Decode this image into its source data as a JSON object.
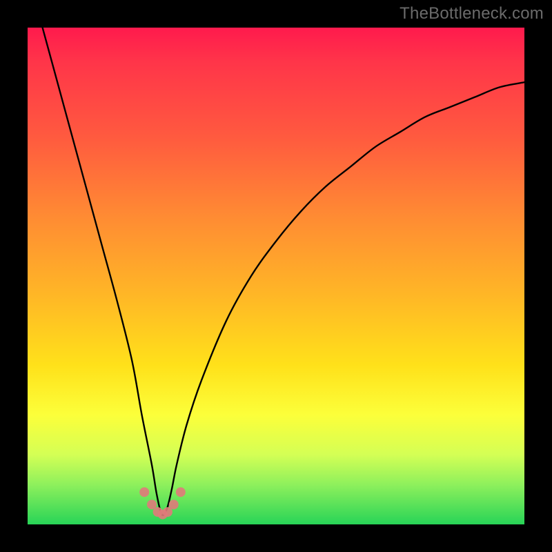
{
  "watermark": "TheBottleneck.com",
  "colors": {
    "frame": "#000000",
    "gradient_top": "#ff1a4d",
    "gradient_mid": "#ffe11a",
    "gradient_bottom": "#28d457",
    "curve_stroke": "#000000",
    "dot_fill": "#e07a7a"
  },
  "chart_data": {
    "type": "line",
    "title": "",
    "xlabel": "",
    "ylabel": "",
    "xlim": [
      0,
      100
    ],
    "ylim": [
      0,
      100
    ],
    "notes": "V-shaped bottleneck curve. x/y values are approximate, read off the plot area proportions (no axis ticks shown). Minimum (bottleneck optimum) near x≈27.",
    "series": [
      {
        "name": "bottleneck-curve",
        "x": [
          3,
          6,
          9,
          12,
          15,
          18,
          21,
          23,
          25,
          26,
          27,
          28,
          29,
          30,
          32,
          35,
          40,
          45,
          50,
          55,
          60,
          65,
          70,
          75,
          80,
          85,
          90,
          95,
          100
        ],
        "values": [
          100,
          89,
          78,
          67,
          56,
          45,
          33,
          22,
          12,
          6,
          2,
          3,
          7,
          12,
          20,
          29,
          41,
          50,
          57,
          63,
          68,
          72,
          76,
          79,
          82,
          84,
          86,
          88,
          89
        ]
      }
    ],
    "markers": [
      {
        "x": 23.5,
        "y": 6.5
      },
      {
        "x": 25.0,
        "y": 4.0
      },
      {
        "x": 26.2,
        "y": 2.5
      },
      {
        "x": 27.2,
        "y": 2.0
      },
      {
        "x": 28.2,
        "y": 2.5
      },
      {
        "x": 29.4,
        "y": 4.0
      },
      {
        "x": 30.8,
        "y": 6.5
      }
    ],
    "background_gradient": {
      "direction": "vertical",
      "stops": [
        {
          "pos": 0.0,
          "color": "#ff1a4d"
        },
        {
          "pos": 0.3,
          "color": "#ff7a36"
        },
        {
          "pos": 0.6,
          "color": "#ffd41f"
        },
        {
          "pos": 0.8,
          "color": "#f9ff3a"
        },
        {
          "pos": 1.0,
          "color": "#28d457"
        }
      ]
    }
  }
}
